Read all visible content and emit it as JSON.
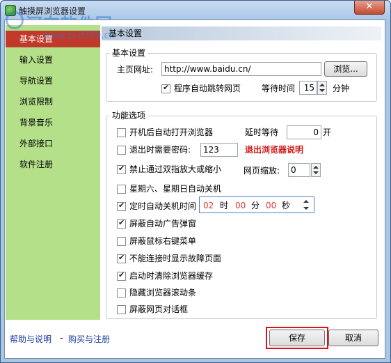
{
  "window": {
    "title": "触摸屏浏览器设置",
    "close_label": "✕"
  },
  "watermark": {
    "text": "河东软件园",
    "url": "www.pc0359.cn"
  },
  "sidebar": {
    "items": [
      {
        "label": "基本设置",
        "active": true
      },
      {
        "label": "输入设置"
      },
      {
        "label": "导航设置"
      },
      {
        "label": "浏览限制"
      },
      {
        "label": "背景音乐"
      },
      {
        "label": "外部接口"
      },
      {
        "label": "软件注册"
      }
    ]
  },
  "content": {
    "header": "基本设置",
    "basic": {
      "legend": "基本设置",
      "homepage_label": "主页网址:",
      "homepage_value": "http://www.baidu.cn/",
      "browse_label": "浏览...",
      "auto_jump_label": "程序自动跳转网页",
      "wait_label": "等待时间",
      "wait_value": "15",
      "wait_unit": "分钟"
    },
    "features": {
      "legend": "功能选项",
      "startup_label": "开机后自动打开浏览器",
      "delay_label": "延时等待",
      "delay_value": "0",
      "delay_unit": "开",
      "exit_pw_label": "退出时需要密码:",
      "exit_pw_value": "123",
      "exit_help": "退出浏览器说明",
      "no_zoom_label": "禁止通过双指放大或缩小",
      "zoom_label": "网页缩放:",
      "zoom_value": "0",
      "weekend_label": "星期六、星期日自动关机",
      "timer_label": "定时自动关机时间",
      "hour": "02",
      "hour_unit": "时",
      "minute": "00",
      "minute_unit": "分",
      "second": "00",
      "second_unit": "秒",
      "block_popup_label": "屏蔽自动广告弹窗",
      "block_rclick_label": "屏蔽鼠标右键菜单",
      "offline_label": "不能连接时显示故障页面",
      "clear_cache_label": "启动时清除浏览器缓存",
      "hide_scroll_label": "隐藏浏览器滚动条",
      "block_dialog_label": "屏蔽网页对话框"
    }
  },
  "footer": {
    "help_label": "帮助与说明",
    "separator": "-",
    "buy_label": "购买与注册",
    "save_label": "保存",
    "cancel_label": "取消"
  }
}
